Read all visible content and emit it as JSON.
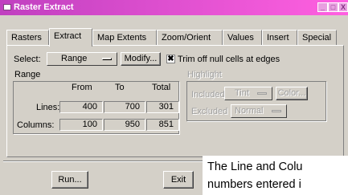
{
  "window": {
    "title": "Raster Extract",
    "accent": "#d050d0"
  },
  "tabs": [
    "Rasters",
    "Extract",
    "Map Extents",
    "Zoom/Orient",
    "Values",
    "Insert",
    "Special"
  ],
  "active_tab": "Extract",
  "select": {
    "label": "Select:",
    "value": "Range",
    "modify_label": "Modify..."
  },
  "trim": {
    "label": "Trim off null cells at edges",
    "checked": true,
    "mark": "✖"
  },
  "range": {
    "title": "Range",
    "headers": [
      "From",
      "To",
      "Total"
    ],
    "rows": [
      {
        "label": "Lines:",
        "from": "400",
        "to": "700",
        "total": "301"
      },
      {
        "label": "Columns:",
        "from": "100",
        "to": "950",
        "total": "851"
      }
    ]
  },
  "highlight": {
    "title": "Highlight",
    "included_label": "Included",
    "included_value": "Tint",
    "color_label": "Color...",
    "excluded_label": "Excluded",
    "excluded_value": "Normal"
  },
  "buttons": {
    "run": "Run...",
    "exit": "Exit"
  },
  "note": {
    "line1": "The Line and Colu",
    "line2": "numbers entered i"
  }
}
